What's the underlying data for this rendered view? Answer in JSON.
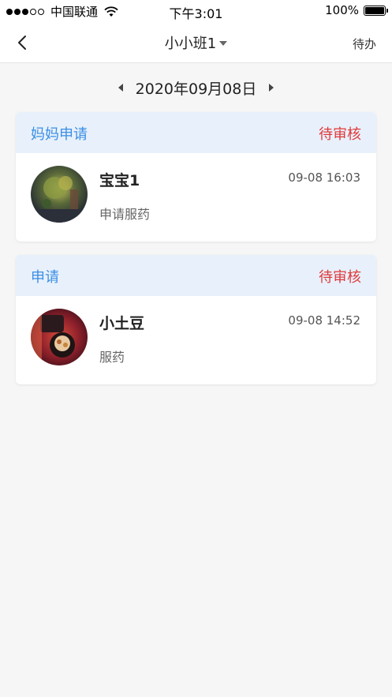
{
  "status_bar": {
    "carrier": "中国联通",
    "time": "下午3:01",
    "battery": "100%"
  },
  "nav": {
    "title": "小小班1",
    "right_label": "待办",
    "back_icon": "chevron-left-icon",
    "title_icon": "caret-down-icon"
  },
  "date_nav": {
    "date": "2020年09月08日",
    "prev_icon": "caret-left-icon",
    "next_icon": "caret-right-icon"
  },
  "colors": {
    "type_blue": "#3a8ee6",
    "status_red": "#e0393b",
    "header_bg": "#e8f1fb"
  },
  "cards": [
    {
      "type": "妈妈申请",
      "status": "待审核",
      "name": "宝宝1",
      "time": "09-08 16:03",
      "description": "申请服药"
    },
    {
      "type": "申请",
      "status": "待审核",
      "name": "小土豆",
      "time": "09-08 14:52",
      "description": "服药"
    }
  ]
}
